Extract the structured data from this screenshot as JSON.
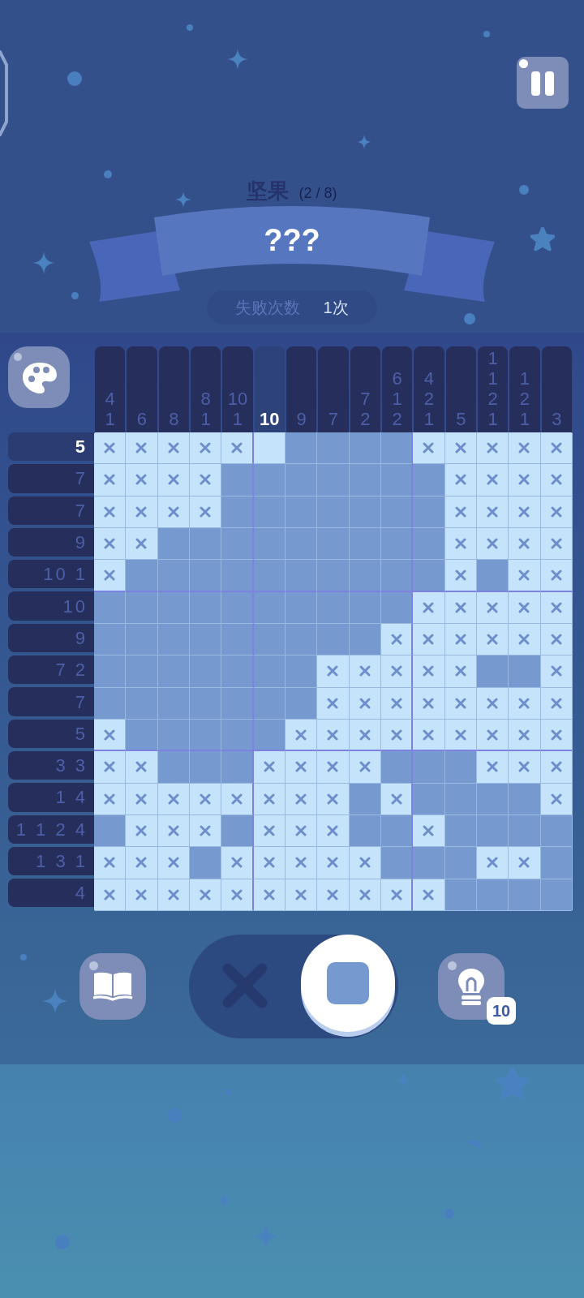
{
  "puzzle": {
    "category": "坚果",
    "progress": "(2 / 8)",
    "title": "???",
    "fail_label": "失败次数",
    "fail_count": "1次"
  },
  "columns": [
    {
      "clues": [
        "4",
        "1"
      ],
      "selected": false
    },
    {
      "clues": [
        "6"
      ],
      "selected": false
    },
    {
      "clues": [
        "8"
      ],
      "selected": false
    },
    {
      "clues": [
        "8",
        "1"
      ],
      "selected": false
    },
    {
      "clues": [
        "10",
        "1"
      ],
      "selected": false
    },
    {
      "clues": [
        "10"
      ],
      "selected": true
    },
    {
      "clues": [
        "9"
      ],
      "selected": false
    },
    {
      "clues": [
        "7"
      ],
      "selected": false
    },
    {
      "clues": [
        "7",
        "2"
      ],
      "selected": false
    },
    {
      "clues": [
        "6",
        "1",
        "2"
      ],
      "selected": false
    },
    {
      "clues": [
        "4",
        "2",
        "1"
      ],
      "selected": false
    },
    {
      "clues": [
        "5"
      ],
      "selected": false
    },
    {
      "clues": [
        "1",
        "1",
        "2",
        "1"
      ],
      "selected": false
    },
    {
      "clues": [
        "1",
        "2",
        "1"
      ],
      "selected": false
    },
    {
      "clues": [
        "3"
      ],
      "selected": false
    }
  ],
  "rows": [
    {
      "clue": "5",
      "selected": true,
      "cells": [
        {
          "kind": "cross"
        },
        {
          "kind": "cross"
        },
        {
          "kind": "cross"
        },
        {
          "kind": "cross"
        },
        {
          "kind": "cross"
        },
        {
          "kind": "empty"
        },
        {
          "kind": "fill"
        },
        {
          "kind": "fill"
        },
        {
          "kind": "fill"
        },
        {
          "kind": "fill"
        },
        {
          "kind": "cross"
        },
        {
          "kind": "cross"
        },
        {
          "kind": "cross"
        },
        {
          "kind": "cross"
        },
        {
          "kind": "cross"
        }
      ]
    },
    {
      "clue": "7",
      "selected": false,
      "cells": [
        {
          "kind": "cross"
        },
        {
          "kind": "cross"
        },
        {
          "kind": "cross"
        },
        {
          "kind": "cross"
        },
        {
          "kind": "fill"
        },
        {
          "kind": "fill"
        },
        {
          "kind": "fill"
        },
        {
          "kind": "fill"
        },
        {
          "kind": "fill"
        },
        {
          "kind": "fill"
        },
        {
          "kind": "fill"
        },
        {
          "kind": "cross"
        },
        {
          "kind": "cross"
        },
        {
          "kind": "cross"
        },
        {
          "kind": "cross"
        }
      ]
    },
    {
      "clue": "7",
      "selected": false,
      "cells": [
        {
          "kind": "cross"
        },
        {
          "kind": "cross"
        },
        {
          "kind": "cross"
        },
        {
          "kind": "cross"
        },
        {
          "kind": "fill"
        },
        {
          "kind": "fill"
        },
        {
          "kind": "fill"
        },
        {
          "kind": "fill"
        },
        {
          "kind": "fill"
        },
        {
          "kind": "fill"
        },
        {
          "kind": "fill"
        },
        {
          "kind": "cross"
        },
        {
          "kind": "cross"
        },
        {
          "kind": "cross"
        },
        {
          "kind": "cross"
        }
      ]
    },
    {
      "clue": "9",
      "selected": false,
      "cells": [
        {
          "kind": "cross"
        },
        {
          "kind": "cross"
        },
        {
          "kind": "fill"
        },
        {
          "kind": "fill"
        },
        {
          "kind": "fill"
        },
        {
          "kind": "fill"
        },
        {
          "kind": "fill"
        },
        {
          "kind": "fill"
        },
        {
          "kind": "fill"
        },
        {
          "kind": "fill"
        },
        {
          "kind": "fill"
        },
        {
          "kind": "cross"
        },
        {
          "kind": "cross"
        },
        {
          "kind": "cross"
        },
        {
          "kind": "cross"
        }
      ]
    },
    {
      "clue": "10 1",
      "selected": false,
      "cells": [
        {
          "kind": "cross"
        },
        {
          "kind": "fill"
        },
        {
          "kind": "fill"
        },
        {
          "kind": "fill"
        },
        {
          "kind": "fill"
        },
        {
          "kind": "fill"
        },
        {
          "kind": "fill"
        },
        {
          "kind": "fill"
        },
        {
          "kind": "fill"
        },
        {
          "kind": "fill"
        },
        {
          "kind": "fill"
        },
        {
          "kind": "cross"
        },
        {
          "kind": "fill"
        },
        {
          "kind": "cross"
        },
        {
          "kind": "cross"
        }
      ]
    },
    {
      "clue": "10",
      "selected": false,
      "cells": [
        {
          "kind": "fill"
        },
        {
          "kind": "fill"
        },
        {
          "kind": "fill"
        },
        {
          "kind": "fill"
        },
        {
          "kind": "fill"
        },
        {
          "kind": "fill"
        },
        {
          "kind": "fill"
        },
        {
          "kind": "fill"
        },
        {
          "kind": "fill"
        },
        {
          "kind": "fill"
        },
        {
          "kind": "cross"
        },
        {
          "kind": "cross"
        },
        {
          "kind": "cross"
        },
        {
          "kind": "cross"
        },
        {
          "kind": "cross"
        }
      ]
    },
    {
      "clue": "9",
      "selected": false,
      "cells": [
        {
          "kind": "fill"
        },
        {
          "kind": "fill"
        },
        {
          "kind": "fill"
        },
        {
          "kind": "fill"
        },
        {
          "kind": "fill"
        },
        {
          "kind": "fill"
        },
        {
          "kind": "fill"
        },
        {
          "kind": "fill"
        },
        {
          "kind": "fill"
        },
        {
          "kind": "cross"
        },
        {
          "kind": "cross"
        },
        {
          "kind": "cross"
        },
        {
          "kind": "cross"
        },
        {
          "kind": "cross"
        },
        {
          "kind": "cross"
        }
      ]
    },
    {
      "clue": "7 2",
      "selected": false,
      "cells": [
        {
          "kind": "fill"
        },
        {
          "kind": "fill"
        },
        {
          "kind": "fill"
        },
        {
          "kind": "fill"
        },
        {
          "kind": "fill"
        },
        {
          "kind": "fill"
        },
        {
          "kind": "fill"
        },
        {
          "kind": "cross"
        },
        {
          "kind": "cross"
        },
        {
          "kind": "cross"
        },
        {
          "kind": "cross"
        },
        {
          "kind": "cross"
        },
        {
          "kind": "fill"
        },
        {
          "kind": "fill"
        },
        {
          "kind": "cross"
        }
      ]
    },
    {
      "clue": "7",
      "selected": false,
      "cells": [
        {
          "kind": "fill"
        },
        {
          "kind": "fill"
        },
        {
          "kind": "fill"
        },
        {
          "kind": "fill"
        },
        {
          "kind": "fill"
        },
        {
          "kind": "fill"
        },
        {
          "kind": "fill"
        },
        {
          "kind": "cross"
        },
        {
          "kind": "cross"
        },
        {
          "kind": "cross"
        },
        {
          "kind": "cross"
        },
        {
          "kind": "cross"
        },
        {
          "kind": "cross"
        },
        {
          "kind": "cross"
        },
        {
          "kind": "cross"
        }
      ]
    },
    {
      "clue": "5",
      "selected": false,
      "cells": [
        {
          "kind": "cross"
        },
        {
          "kind": "fill"
        },
        {
          "kind": "fill"
        },
        {
          "kind": "fill"
        },
        {
          "kind": "fill"
        },
        {
          "kind": "fill"
        },
        {
          "kind": "cross"
        },
        {
          "kind": "cross"
        },
        {
          "kind": "cross"
        },
        {
          "kind": "cross"
        },
        {
          "kind": "cross"
        },
        {
          "kind": "cross"
        },
        {
          "kind": "cross"
        },
        {
          "kind": "cross"
        },
        {
          "kind": "cross"
        }
      ]
    },
    {
      "clue": "3 3",
      "selected": false,
      "cells": [
        {
          "kind": "cross"
        },
        {
          "kind": "cross"
        },
        {
          "kind": "fill"
        },
        {
          "kind": "fill"
        },
        {
          "kind": "fill"
        },
        {
          "kind": "cross"
        },
        {
          "kind": "cross"
        },
        {
          "kind": "cross"
        },
        {
          "kind": "cross"
        },
        {
          "kind": "fill"
        },
        {
          "kind": "fill"
        },
        {
          "kind": "fill"
        },
        {
          "kind": "cross"
        },
        {
          "kind": "cross"
        },
        {
          "kind": "cross"
        }
      ]
    },
    {
      "clue": "1 4",
      "selected": false,
      "cells": [
        {
          "kind": "cross"
        },
        {
          "kind": "cross"
        },
        {
          "kind": "cross"
        },
        {
          "kind": "cross"
        },
        {
          "kind": "cross"
        },
        {
          "kind": "cross"
        },
        {
          "kind": "cross"
        },
        {
          "kind": "cross"
        },
        {
          "kind": "fill"
        },
        {
          "kind": "cross"
        },
        {
          "kind": "fill"
        },
        {
          "kind": "fill"
        },
        {
          "kind": "fill"
        },
        {
          "kind": "fill"
        },
        {
          "kind": "cross"
        }
      ]
    },
    {
      "clue": "1 1 2 4",
      "selected": false,
      "cells": [
        {
          "kind": "fill"
        },
        {
          "kind": "cross"
        },
        {
          "kind": "cross"
        },
        {
          "kind": "cross"
        },
        {
          "kind": "fill"
        },
        {
          "kind": "cross"
        },
        {
          "kind": "cross"
        },
        {
          "kind": "cross"
        },
        {
          "kind": "fill"
        },
        {
          "kind": "fill"
        },
        {
          "kind": "cross"
        },
        {
          "kind": "fill"
        },
        {
          "kind": "fill"
        },
        {
          "kind": "fill"
        },
        {
          "kind": "fill"
        }
      ]
    },
    {
      "clue": "1 3 1",
      "selected": false,
      "cells": [
        {
          "kind": "cross"
        },
        {
          "kind": "cross"
        },
        {
          "kind": "cross"
        },
        {
          "kind": "fill"
        },
        {
          "kind": "cross"
        },
        {
          "kind": "cross"
        },
        {
          "kind": "cross"
        },
        {
          "kind": "cross"
        },
        {
          "kind": "cross"
        },
        {
          "kind": "fill"
        },
        {
          "kind": "fill"
        },
        {
          "kind": "fill"
        },
        {
          "kind": "cross"
        },
        {
          "kind": "cross"
        },
        {
          "kind": "fill"
        }
      ]
    },
    {
      "clue": "4",
      "selected": false,
      "cells": [
        {
          "kind": "cross"
        },
        {
          "kind": "cross"
        },
        {
          "kind": "cross"
        },
        {
          "kind": "cross"
        },
        {
          "kind": "cross"
        },
        {
          "kind": "cross"
        },
        {
          "kind": "cross"
        },
        {
          "kind": "cross"
        },
        {
          "kind": "cross"
        },
        {
          "kind": "cross"
        },
        {
          "kind": "cross"
        },
        {
          "kind": "fill"
        },
        {
          "kind": "fill"
        },
        {
          "kind": "fill"
        },
        {
          "kind": "fill"
        }
      ]
    }
  ],
  "mode_toggle": {
    "fill_selected": true
  },
  "hint_count": "10"
}
